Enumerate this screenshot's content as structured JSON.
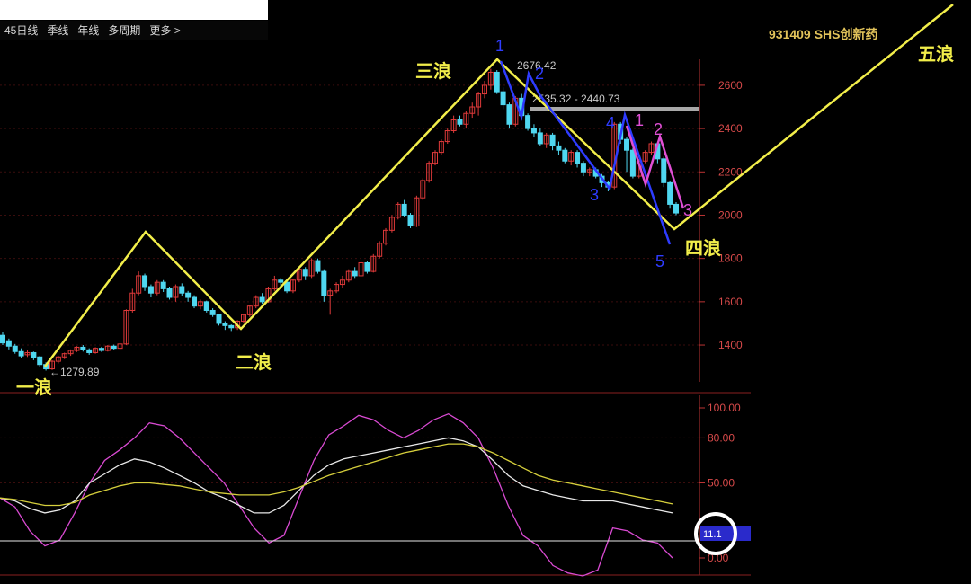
{
  "toolbar": {
    "tabs": [
      "45日线",
      "季线",
      "年线",
      "多周期",
      "更多 >"
    ]
  },
  "stock": {
    "code": "931409",
    "name": "SHS创新药"
  },
  "annotations": {
    "high": "2676.42",
    "range": "2535.32 - 2440.73",
    "low": "←1279.89",
    "current_indicator": "11.1"
  },
  "wave_labels": [
    "一浪",
    "二浪",
    "三浪",
    "四浪",
    "五浪"
  ],
  "sub_waves_blue": [
    "1",
    "2",
    "3",
    "4",
    "5"
  ],
  "sub_waves_pink": [
    "1",
    "2",
    "3"
  ],
  "colors": {
    "background": "#000000",
    "up_candle": "#e03a3a",
    "down_candle": "#4fd7f0",
    "wave_line": "#f2ee4a",
    "blue_wave": "#2e3cff",
    "pink_wave": "#e04fd5",
    "axis": "#d84a4a"
  },
  "chart_data": [
    {
      "type": "line",
      "subtype": "candlestick-with-elliott-wave",
      "price_axis": {
        "ticks": [
          1400,
          1600,
          1800,
          2000,
          2200,
          2400,
          2600
        ],
        "ylim": [
          1230,
          2720
        ]
      },
      "elliott_wave_points": [
        {
          "label": "一浪",
          "price": 1280
        },
        {
          "label": "",
          "price": 1910
        },
        {
          "label": "二浪",
          "price": 1465
        },
        {
          "label": "三浪",
          "price": 2676
        },
        {
          "label": "四浪",
          "price": 1920
        },
        {
          "label": "五浪",
          "price": null
        }
      ],
      "candles": [
        [
          1445,
          1410,
          1460,
          1400
        ],
        [
          1420,
          1395,
          1430,
          1380
        ],
        [
          1395,
          1370,
          1405,
          1360
        ],
        [
          1370,
          1350,
          1385,
          1340
        ],
        [
          1355,
          1365,
          1375,
          1345
        ],
        [
          1365,
          1340,
          1370,
          1330
        ],
        [
          1345,
          1310,
          1350,
          1300
        ],
        [
          1310,
          1290,
          1320,
          1282
        ],
        [
          1290,
          1325,
          1330,
          1285
        ],
        [
          1325,
          1345,
          1350,
          1315
        ],
        [
          1345,
          1360,
          1365,
          1335
        ],
        [
          1360,
          1375,
          1380,
          1350
        ],
        [
          1375,
          1390,
          1395,
          1368
        ],
        [
          1390,
          1378,
          1400,
          1370
        ],
        [
          1378,
          1365,
          1385,
          1355
        ],
        [
          1365,
          1385,
          1390,
          1360
        ],
        [
          1385,
          1375,
          1392,
          1368
        ],
        [
          1375,
          1395,
          1400,
          1370
        ],
        [
          1395,
          1385,
          1402,
          1378
        ],
        [
          1385,
          1405,
          1410,
          1380
        ],
        [
          1405,
          1560,
          1565,
          1400
        ],
        [
          1560,
          1640,
          1660,
          1550
        ],
        [
          1640,
          1720,
          1740,
          1630
        ],
        [
          1720,
          1670,
          1730,
          1650
        ],
        [
          1670,
          1640,
          1680,
          1620
        ],
        [
          1640,
          1690,
          1700,
          1630
        ],
        [
          1690,
          1660,
          1700,
          1645
        ],
        [
          1660,
          1620,
          1670,
          1610
        ],
        [
          1620,
          1670,
          1680,
          1600
        ],
        [
          1670,
          1640,
          1685,
          1625
        ],
        [
          1640,
          1620,
          1650,
          1600
        ],
        [
          1620,
          1580,
          1630,
          1570
        ],
        [
          1580,
          1600,
          1610,
          1565
        ],
        [
          1600,
          1560,
          1605,
          1550
        ],
        [
          1560,
          1540,
          1570,
          1530
        ],
        [
          1540,
          1500,
          1545,
          1490
        ],
        [
          1500,
          1490,
          1510,
          1470
        ],
        [
          1490,
          1480,
          1495,
          1465
        ],
        [
          1480,
          1510,
          1515,
          1470
        ],
        [
          1510,
          1540,
          1545,
          1500
        ],
        [
          1540,
          1580,
          1585,
          1530
        ],
        [
          1580,
          1620,
          1630,
          1570
        ],
        [
          1620,
          1600,
          1640,
          1590
        ],
        [
          1600,
          1660,
          1670,
          1595
        ],
        [
          1660,
          1700,
          1720,
          1650
        ],
        [
          1700,
          1690,
          1710,
          1670
        ],
        [
          1690,
          1650,
          1700,
          1640
        ],
        [
          1650,
          1700,
          1705,
          1640
        ],
        [
          1700,
          1750,
          1760,
          1690
        ],
        [
          1750,
          1720,
          1760,
          1700
        ],
        [
          1720,
          1790,
          1800,
          1710
        ],
        [
          1790,
          1740,
          1800,
          1730
        ],
        [
          1740,
          1630,
          1750,
          1600
        ],
        [
          1630,
          1650,
          1660,
          1540
        ],
        [
          1650,
          1680,
          1690,
          1640
        ],
        [
          1680,
          1700,
          1720,
          1665
        ],
        [
          1700,
          1740,
          1750,
          1690
        ],
        [
          1740,
          1720,
          1760,
          1710
        ],
        [
          1720,
          1780,
          1790,
          1715
        ],
        [
          1780,
          1740,
          1790,
          1730
        ],
        [
          1740,
          1810,
          1820,
          1735
        ],
        [
          1810,
          1870,
          1880,
          1800
        ],
        [
          1870,
          1930,
          1940,
          1860
        ],
        [
          1930,
          1990,
          2000,
          1920
        ],
        [
          1990,
          2050,
          2060,
          1980
        ],
        [
          2050,
          2000,
          2070,
          1990
        ],
        [
          2000,
          1950,
          2010,
          1940
        ],
        [
          1950,
          2080,
          2090,
          1945
        ],
        [
          2080,
          2160,
          2170,
          2070
        ],
        [
          2160,
          2240,
          2250,
          2150
        ],
        [
          2240,
          2290,
          2300,
          2230
        ],
        [
          2290,
          2340,
          2350,
          2280
        ],
        [
          2340,
          2390,
          2400,
          2330
        ],
        [
          2390,
          2440,
          2460,
          2380
        ],
        [
          2440,
          2420,
          2460,
          2410
        ],
        [
          2420,
          2470,
          2480,
          2400
        ],
        [
          2470,
          2500,
          2520,
          2450
        ],
        [
          2500,
          2560,
          2570,
          2460
        ],
        [
          2560,
          2600,
          2620,
          2540
        ],
        [
          2600,
          2660,
          2676,
          2580
        ],
        [
          2660,
          2570,
          2670,
          2560
        ],
        [
          2570,
          2510,
          2590,
          2490
        ],
        [
          2510,
          2420,
          2520,
          2400
        ],
        [
          2420,
          2540,
          2550,
          2410
        ],
        [
          2540,
          2460,
          2560,
          2440
        ],
        [
          2460,
          2400,
          2470,
          2390
        ],
        [
          2400,
          2380,
          2420,
          2360
        ],
        [
          2380,
          2330,
          2400,
          2320
        ],
        [
          2330,
          2370,
          2380,
          2310
        ],
        [
          2370,
          2320,
          2380,
          2300
        ],
        [
          2320,
          2300,
          2340,
          2280
        ],
        [
          2300,
          2250,
          2310,
          2240
        ],
        [
          2250,
          2290,
          2300,
          2230
        ],
        [
          2290,
          2240,
          2300,
          2220
        ],
        [
          2240,
          2200,
          2250,
          2180
        ],
        [
          2200,
          2210,
          2220,
          2180
        ],
        [
          2210,
          2180,
          2220,
          2170
        ],
        [
          2180,
          2150,
          2190,
          2130
        ],
        [
          2150,
          2130,
          2160,
          2110
        ],
        [
          2130,
          2420,
          2430,
          2120
        ],
        [
          2420,
          2350,
          2430,
          2330
        ],
        [
          2350,
          2300,
          2360,
          2200
        ],
        [
          2300,
          2180,
          2310,
          2170
        ],
        [
          2180,
          2250,
          2260,
          2170
        ],
        [
          2250,
          2290,
          2300,
          2240
        ],
        [
          2290,
          2330,
          2340,
          2280
        ],
        [
          2330,
          2260,
          2340,
          2240
        ],
        [
          2260,
          2150,
          2270,
          2130
        ],
        [
          2150,
          2050,
          2160,
          2030
        ],
        [
          2050,
          2010,
          2060,
          2000
        ]
      ]
    },
    {
      "type": "line",
      "subtype": "oscillator",
      "ylim": [
        0,
        100
      ],
      "ticks": [
        "100.00",
        "80.00",
        "50.00",
        "0.00"
      ],
      "current_value": 11.1,
      "series": [
        {
          "name": "",
          "color": "#d94ad2",
          "values": [
            40,
            34,
            18,
            8,
            12,
            30,
            50,
            65,
            72,
            80,
            90,
            88,
            80,
            70,
            60,
            50,
            35,
            20,
            10,
            15,
            40,
            65,
            82,
            88,
            95,
            92,
            85,
            80,
            85,
            92,
            96,
            90,
            80,
            60,
            35,
            15,
            8,
            -5,
            -10,
            -12,
            -8,
            20,
            18,
            12,
            10,
            0
          ]
        },
        {
          "name": "",
          "color": "#e8e8e8",
          "values": [
            40,
            38,
            33,
            30,
            32,
            38,
            50,
            56,
            62,
            66,
            64,
            60,
            55,
            50,
            44,
            40,
            35,
            30,
            30,
            35,
            45,
            55,
            62,
            66,
            68,
            70,
            72,
            74,
            76,
            78,
            80,
            78,
            74,
            65,
            55,
            48,
            45,
            42,
            40,
            38,
            38,
            38,
            36,
            34,
            32,
            30
          ]
        },
        {
          "name": "",
          "color": "#d6cf3c",
          "values": [
            40,
            39,
            37,
            35,
            35,
            37,
            42,
            45,
            48,
            50,
            50,
            49,
            48,
            46,
            44,
            43,
            42,
            42,
            42,
            44,
            47,
            51,
            55,
            58,
            61,
            64,
            67,
            70,
            72,
            74,
            76,
            76,
            74,
            70,
            65,
            60,
            55,
            52,
            50,
            48,
            46,
            44,
            42,
            40,
            38,
            36
          ]
        }
      ]
    }
  ]
}
